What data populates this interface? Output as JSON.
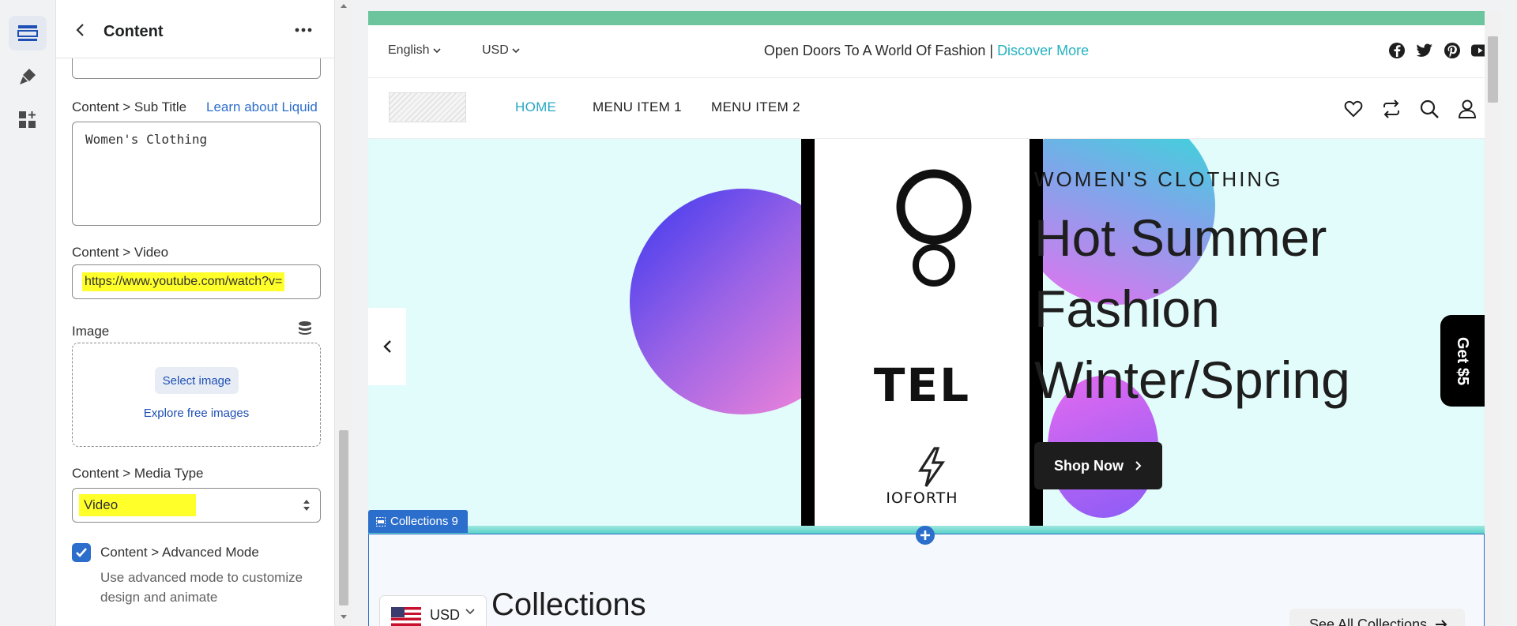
{
  "panel": {
    "title": "Content",
    "sub_title_label": "Content > Sub Title",
    "learn_link": "Learn about Liquid",
    "sub_title_value": "Women's Clothing",
    "video_label": "Content > Video",
    "video_value": "https://www.youtube.com/watch?v=",
    "image_label": "Image",
    "select_image": "Select image",
    "explore_images": "Explore free images",
    "media_type_label": "Content > Media Type",
    "media_type_value": "Video",
    "advanced_label": "Content > Advanced Mode",
    "advanced_help": "Use advanced mode to customize design and animate",
    "advanced_checked": true
  },
  "store": {
    "language": "English",
    "currency": "USD",
    "announcement": "Open Doors To A World Of Fashion |",
    "announcement_link": "Discover More",
    "nav": [
      "HOME",
      "MENU ITEM 1",
      "MENU ITEM 2"
    ],
    "hero": {
      "subtitle": "WOMEN'S CLOTHING",
      "title": "Hot Summer Fashion Winter/Spring",
      "button": "Shop Now",
      "poster_text": "TEL",
      "poster_brand": "IOFORTH"
    },
    "side_tab": "Get $5",
    "section_tag": "Collections 9",
    "currency_pill": "USD",
    "collections_title": "Collections",
    "see_all": "See All Collections"
  },
  "colors": {
    "accent_blue": "#2c6ecb",
    "highlight": "#ffff2a",
    "top_strip": "#6cc59c",
    "nav_active": "#25a7c2",
    "hero_bg": "#e2fbfb"
  }
}
